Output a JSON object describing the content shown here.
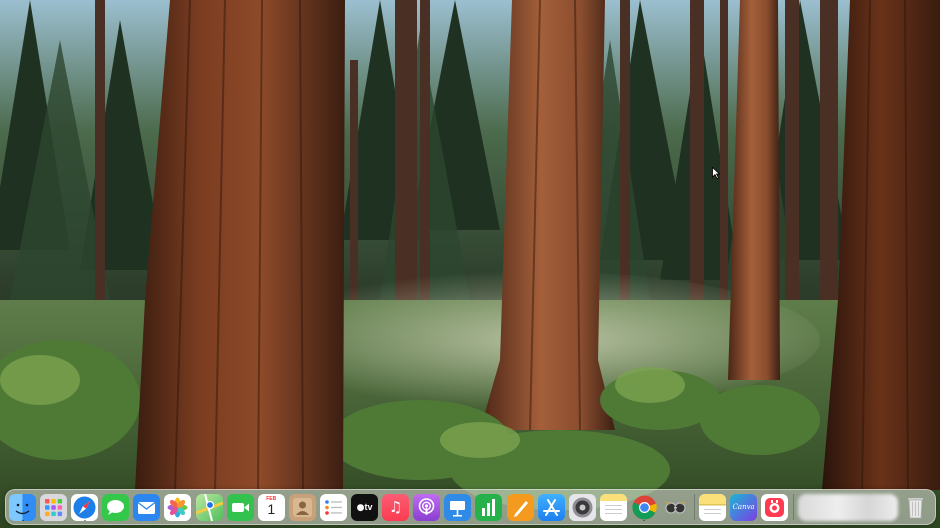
{
  "desktop": {
    "wallpaper_name": "sequoia-forest-wallpaper"
  },
  "dock": {
    "apps": [
      {
        "id": "finder",
        "icon": "finder-icon",
        "color": "#2f8df5",
        "running": true
      },
      {
        "id": "launchpad",
        "icon": "launchpad-icon",
        "color": "#d9d9dd",
        "running": false
      },
      {
        "id": "safari",
        "icon": "safari-icon",
        "color": "#1f7fe8",
        "running": true
      },
      {
        "id": "messages",
        "icon": "messages-icon",
        "color": "#34c84a",
        "running": false
      },
      {
        "id": "mail",
        "icon": "mail-icon",
        "color": "#2c86ef",
        "running": false
      },
      {
        "id": "photos",
        "icon": "photos-icon",
        "color": "#ffffff",
        "running": false
      },
      {
        "id": "maps",
        "icon": "maps-icon",
        "color": "#4fbf5a",
        "running": false
      },
      {
        "id": "facetime",
        "icon": "facetime-icon",
        "color": "#33c24d",
        "running": false
      },
      {
        "id": "calendar",
        "icon": "calendar-icon",
        "color": "#ffffff",
        "running": false
      },
      {
        "id": "contacts",
        "icon": "contacts-icon",
        "color": "#b48b62",
        "running": false
      },
      {
        "id": "reminders",
        "icon": "reminders-icon",
        "color": "#ffffff",
        "running": false
      },
      {
        "id": "tv",
        "icon": "apple-tv-icon",
        "color": "#111111",
        "running": false
      },
      {
        "id": "music",
        "icon": "music-icon",
        "color": "#fb3c4f",
        "running": false
      },
      {
        "id": "podcasts",
        "icon": "podcasts-icon",
        "color": "#9a4ed8",
        "running": false
      },
      {
        "id": "keynote",
        "icon": "keynote-icon",
        "color": "#2f8be6",
        "running": false
      },
      {
        "id": "numbers",
        "icon": "numbers-icon",
        "color": "#27b14b",
        "running": false
      },
      {
        "id": "pages",
        "icon": "pages-icon",
        "color": "#f39a1f",
        "running": false
      },
      {
        "id": "app-store",
        "icon": "app-store-icon",
        "color": "#1e8ff0",
        "running": false
      },
      {
        "id": "system-settings",
        "icon": "gear-icon",
        "color": "#8e8e93",
        "running": false
      },
      {
        "id": "notes",
        "icon": "notes-icon",
        "color": "#fbe07a",
        "running": false
      },
      {
        "id": "chrome",
        "icon": "chrome-icon",
        "color": "#ffffff",
        "running": true
      },
      {
        "id": "preview",
        "icon": "preview-icon",
        "color": "#6b6b6b",
        "running": false
      }
    ],
    "recent_apps": [
      {
        "id": "notes-recent",
        "icon": "notes-icon",
        "color": "#fbe07a",
        "running": false
      },
      {
        "id": "canva",
        "icon": "canva-icon",
        "color": "#1fb6d6",
        "running": false,
        "label": "Canva"
      },
      {
        "id": "screen-recorder",
        "icon": "recorder-icon",
        "color": "#ff3b52",
        "running": false
      }
    ],
    "calendar": {
      "month": "FEB",
      "day": "1"
    },
    "tv_label": "tv",
    "trash": {
      "icon": "trash-icon"
    }
  }
}
